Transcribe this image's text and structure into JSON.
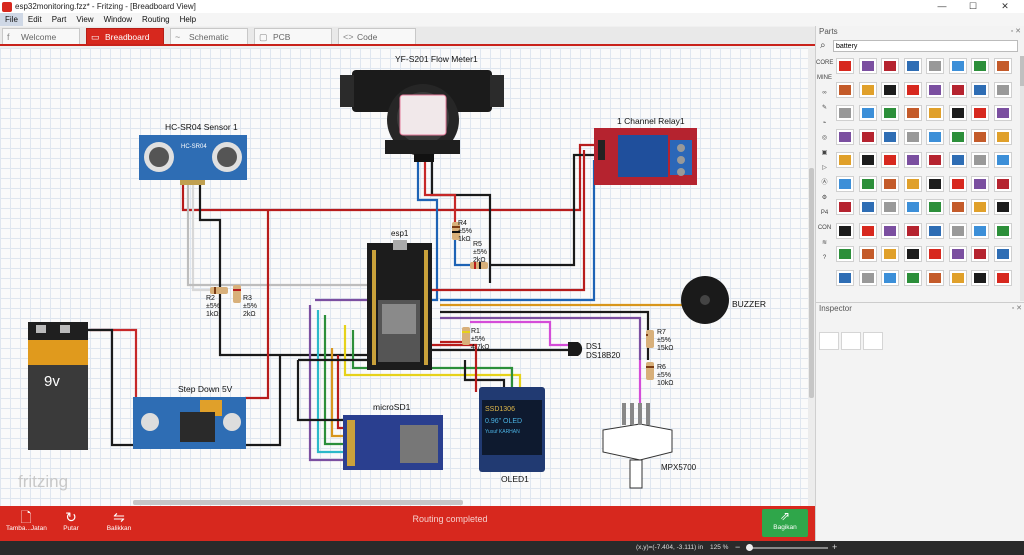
{
  "window": {
    "title": "esp32monitoring.fzz* - Fritzing - [Breadboard View]",
    "controls": {
      "minimize": "—",
      "maximize": "☐",
      "close": "✕"
    }
  },
  "menu": [
    "File",
    "Edit",
    "Part",
    "View",
    "Window",
    "Routing",
    "Help"
  ],
  "tabs": [
    {
      "label": "Welcome",
      "icon": "f"
    },
    {
      "label": "Breadboard",
      "icon": "▭"
    },
    {
      "label": "Schematic",
      "icon": "~"
    },
    {
      "label": "PCB",
      "icon": "▢"
    },
    {
      "label": "Code",
      "icon": "<>"
    }
  ],
  "canvas": {
    "logo": "fritzing",
    "parts": {
      "flow_meter": "YF-S201 Flow Meter1",
      "hcsr04": "HC-SR04 Sensor 1",
      "hcsr04_board": "HC-SR04",
      "relay": "1 Channel Relay1",
      "esp": "esp1",
      "r4": [
        "R4",
        "±5%",
        "1kΩ"
      ],
      "r5": [
        "R5",
        "±5%",
        "2kΩ"
      ],
      "r2": [
        "R2",
        "±5%",
        "1kΩ"
      ],
      "r3": [
        "R3",
        "±5%",
        "2kΩ"
      ],
      "r1": [
        "R1",
        "±5%",
        "4.7kΩ"
      ],
      "r7": [
        "R7",
        "±5%",
        "15kΩ"
      ],
      "r6": [
        "R6",
        "±5%",
        "10kΩ"
      ],
      "ds1": [
        "DS1",
        "DS18B20"
      ],
      "buzzer": "BUZZER",
      "battery": "9v",
      "stepdown": "Step Down 5V",
      "microsd": "microSD1",
      "oled": "OLED1",
      "oled_screen": [
        "SSD1306",
        "0.96\" OLED",
        "Yusuf KARHAN"
      ],
      "mpx": "MPX5700"
    }
  },
  "bottom": {
    "buttons": [
      {
        "label": "Tamba...Jatan",
        "icon": "🗋"
      },
      {
        "label": "Putar",
        "icon": "↻"
      },
      {
        "label": "Balikkan",
        "icon": "⇋"
      }
    ],
    "routing_status": "Routing completed",
    "share": {
      "label": "Bagikan",
      "icon": "⇗"
    }
  },
  "status": {
    "coords": "(x,y)=(-7.404, -3.111) in",
    "zoom": "125 %",
    "zoom_minus": "−",
    "zoom_plus": "+"
  },
  "parts_panel": {
    "title": "Parts",
    "search_value": "battery",
    "bins": [
      "CORE",
      "MINE",
      "∞",
      "✎",
      "⌁",
      "◎",
      "▣",
      "▷",
      "Ⓐ",
      "⚙",
      "P4",
      "CON",
      "≋",
      "?"
    ]
  },
  "inspector": {
    "title": "Inspector"
  },
  "colors": {
    "accent": "#d7281e",
    "share": "#2fa64a",
    "status": "#2a2a2a"
  }
}
